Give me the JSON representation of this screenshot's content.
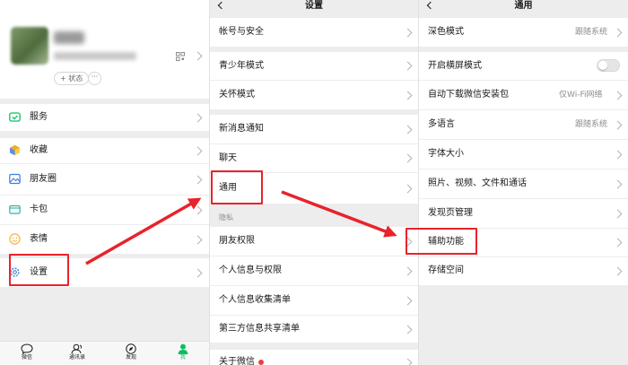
{
  "me_page": {
    "status_label": "+ 状态",
    "more_label": "···",
    "items": [
      {
        "key": "services",
        "label": "服务"
      },
      {
        "key": "favorites",
        "label": "收藏"
      },
      {
        "key": "moments",
        "label": "朋友圈"
      },
      {
        "key": "cards",
        "label": "卡包"
      },
      {
        "key": "stickers",
        "label": "表情"
      },
      {
        "key": "settings",
        "label": "设置"
      }
    ],
    "tabs": [
      {
        "key": "chats",
        "label": "微信"
      },
      {
        "key": "contacts",
        "label": "通讯录"
      },
      {
        "key": "discover",
        "label": "发现"
      },
      {
        "key": "me",
        "label": "我"
      }
    ]
  },
  "settings_page": {
    "title": "设置",
    "items": [
      {
        "key": "account",
        "label": "帐号与安全"
      },
      {
        "key": "teen",
        "label": "青少年模式"
      },
      {
        "key": "care",
        "label": "关怀模式"
      },
      {
        "key": "notifications",
        "label": "新消息通知"
      },
      {
        "key": "chat",
        "label": "聊天"
      },
      {
        "key": "general",
        "label": "通用"
      },
      {
        "key": "friend_perm",
        "label": "朋友权限"
      },
      {
        "key": "personal_info",
        "label": "个人信息与权限"
      },
      {
        "key": "info_collection",
        "label": "个人信息收集清单"
      },
      {
        "key": "third_party",
        "label": "第三方信息共享清单"
      },
      {
        "key": "about",
        "label": "关于微信"
      }
    ],
    "privacy_section": "隐私"
  },
  "general_page": {
    "title": "通用",
    "items": [
      {
        "key": "dark_mode",
        "label": "深色模式",
        "value": "跟随系统"
      },
      {
        "key": "landscape",
        "label": "开启横屏模式",
        "toggle": "off"
      },
      {
        "key": "auto_download",
        "label": "自动下载微信安装包",
        "value": "仅Wi-Fi网络"
      },
      {
        "key": "language",
        "label": "多语言",
        "value": "跟随系统"
      },
      {
        "key": "font_size",
        "label": "字体大小"
      },
      {
        "key": "media",
        "label": "照片、视频、文件和通话"
      },
      {
        "key": "discover_mgmt",
        "label": "发现页管理"
      },
      {
        "key": "accessibility",
        "label": "辅助功能"
      },
      {
        "key": "storage",
        "label": "存储空间"
      }
    ]
  },
  "colors": {
    "highlight": "#e8232b",
    "wechat_green": "#07c160",
    "toggle_off": "#e5e5e5"
  }
}
